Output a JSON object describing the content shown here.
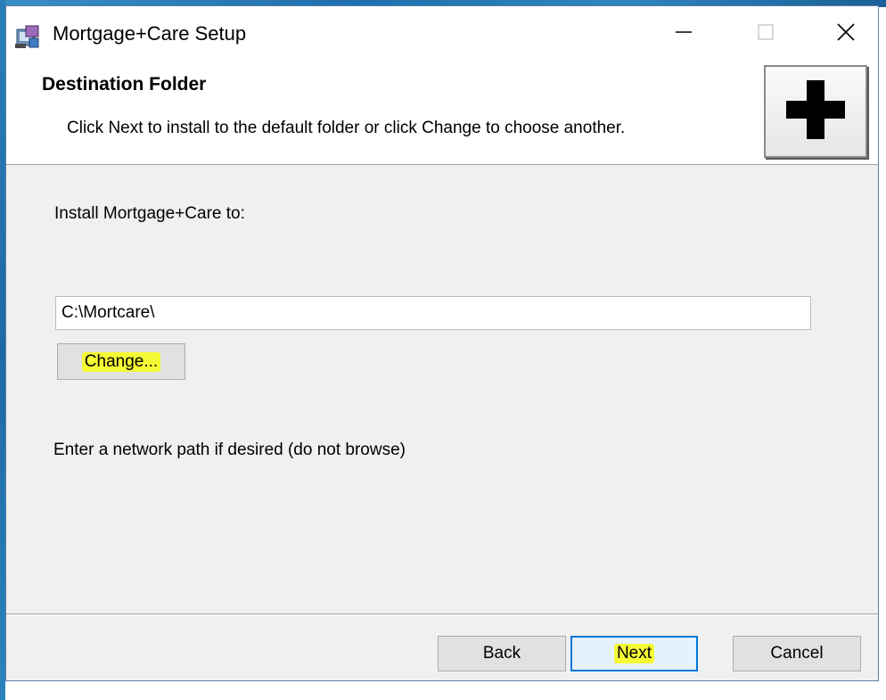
{
  "window": {
    "title": "Mortgage+Care Setup",
    "controls": {
      "minimize_icon": "minimize-icon",
      "maximize_icon": "maximize-icon",
      "close_icon": "close-icon"
    }
  },
  "banner": {
    "title": "Destination Folder",
    "description": "Click Next to install to the default folder or click Change to choose another.",
    "logo_icon": "plus-icon"
  },
  "main": {
    "install_label": "Install Mortgage+Care to:",
    "path_value": "C:\\Mortcare\\",
    "change_label": "Change...",
    "network_hint": "Enter a network path if desired (do not browse)"
  },
  "footer": {
    "back_label": "Back",
    "next_label": "Next",
    "cancel_label": "Cancel"
  },
  "colors": {
    "highlight": "#f5fa35",
    "focus_border": "#0078d7",
    "dialog_bg": "#f0f0f0"
  }
}
